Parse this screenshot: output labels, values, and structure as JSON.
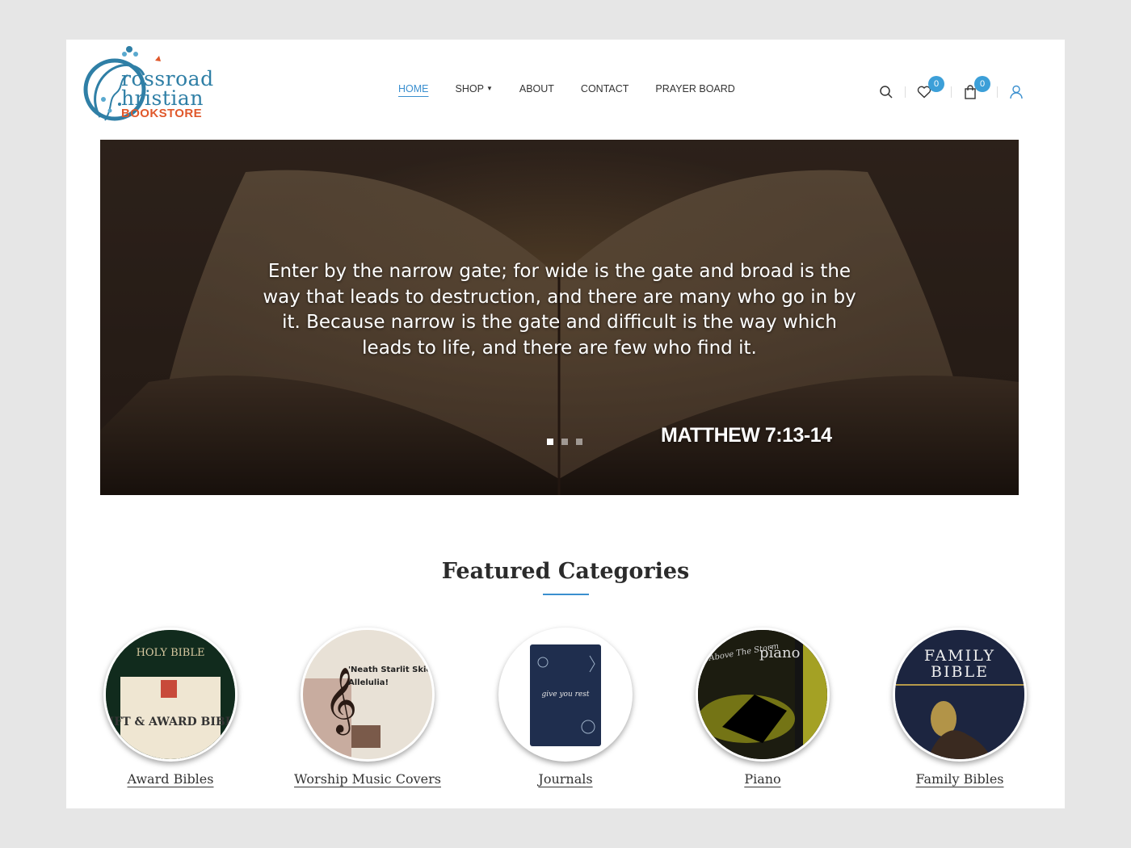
{
  "logo": {
    "line1": "rossroad",
    "line2": "hristian",
    "line3": "BOOKSTORE"
  },
  "nav": {
    "items": [
      {
        "label": "HOME",
        "active": true
      },
      {
        "label": "SHOP",
        "dropdown": true
      },
      {
        "label": "ABOUT"
      },
      {
        "label": "CONTACT"
      },
      {
        "label": "PRAYER BOARD"
      }
    ]
  },
  "header_icons": {
    "search": "search-icon",
    "wishlist": "heart-icon",
    "wishlist_count": "0",
    "cart": "bag-icon",
    "cart_count": "0",
    "account": "user-icon"
  },
  "hero": {
    "quote": "Enter by the narrow gate; for wide is the gate and broad is the way that leads to destruction, and there are many who go in by it. Because narrow is the gate and difficult is the way which leads to life, and there are few who find it.",
    "reference": "MATTHEW  7:13-14",
    "slides": 3,
    "active_slide": 1
  },
  "featured": {
    "title": "Featured Categories",
    "categories": [
      {
        "label": "Award Bibles",
        "image_text": [
          "HOLY BIBLE",
          "GIFT & AWARD BIBLE"
        ]
      },
      {
        "label": "Worship Music Covers",
        "image_text": [
          "'Neath Starlit Skies",
          "Allelulia!"
        ]
      },
      {
        "label": "Journals",
        "image_text": [
          "give you rest"
        ]
      },
      {
        "label": "Piano",
        "image_text": [
          "piano",
          "Above The Storm"
        ]
      },
      {
        "label": "Family Bibles",
        "image_text": [
          "FAMILY",
          "BIBLE"
        ]
      }
    ]
  },
  "colors": {
    "accent": "#3a8fcf",
    "badge": "#3c9fd8",
    "logo_blue": "#2f7fa6",
    "logo_orange": "#e0582b"
  }
}
